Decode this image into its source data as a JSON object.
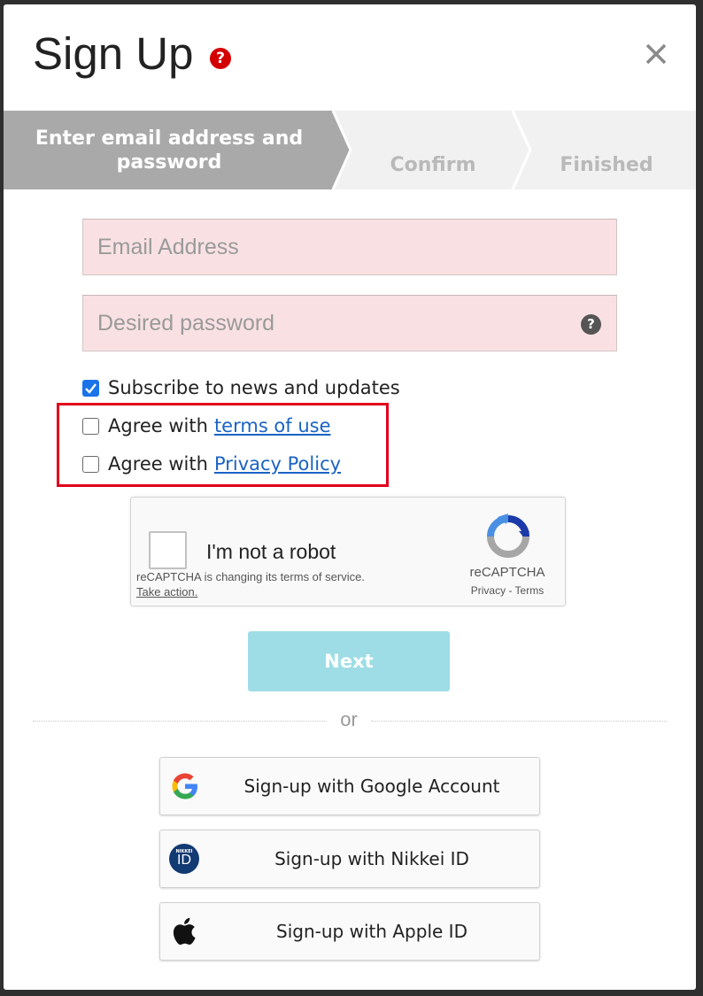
{
  "dialog": {
    "title": "Sign Up",
    "help_icon": "question-circle-icon",
    "close_icon": "close-icon"
  },
  "steps": [
    {
      "line1": "Enter email address and",
      "line2": "password",
      "active": true
    },
    {
      "label": "Confirm",
      "active": false
    },
    {
      "label": "Finished",
      "active": false
    }
  ],
  "form": {
    "email_placeholder": "Email Address",
    "password_placeholder": "Desired password",
    "subscribe_label": "Subscribe to news and updates",
    "subscribe_checked": true,
    "terms_prefix": "Agree with",
    "terms_link": "terms of use",
    "terms_checked": false,
    "privacy_prefix": "Agree with",
    "privacy_link": "Privacy Policy",
    "privacy_checked": false
  },
  "recaptcha": {
    "label": "I'm not a robot",
    "notice": "reCAPTCHA is changing its terms of service.",
    "action": "Take action.",
    "brand": "reCAPTCHA",
    "links": "Privacy - Terms"
  },
  "next_button": "Next",
  "divider_text": "or",
  "social": {
    "google": "Sign-up with Google Account",
    "nikkei": "Sign-up with Nikkei ID",
    "nikkei_icon_top": "NIKKEI",
    "nikkei_icon_main": "ID",
    "apple": "Sign-up with Apple ID"
  },
  "colors": {
    "step_active": "#a9a9a9",
    "field_bg": "#f9e1e3",
    "next_button_bg": "#9edde6",
    "highlight_box": "#e0001a",
    "link": "#1a63c4"
  }
}
